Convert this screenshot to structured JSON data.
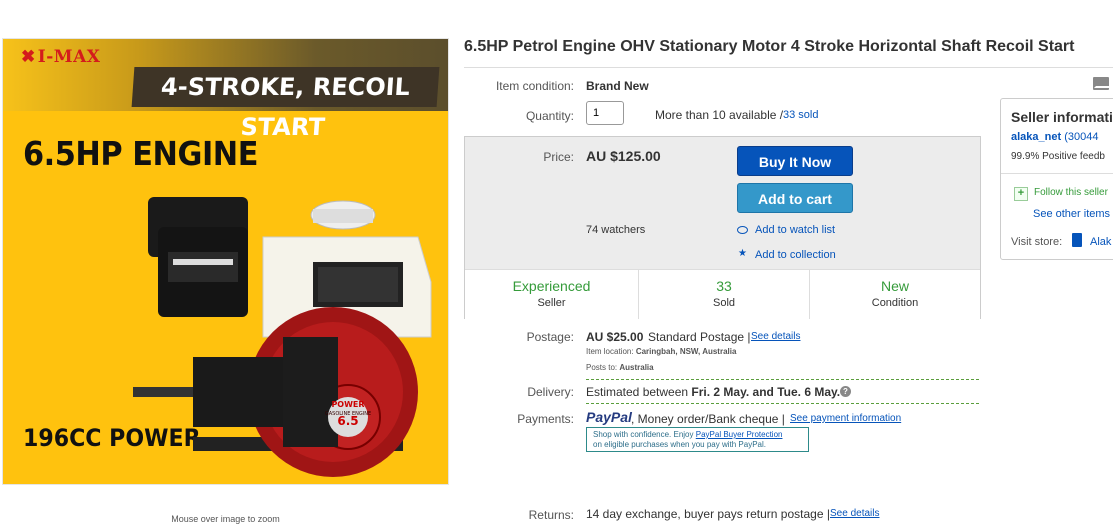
{
  "image": {
    "logo": "I-MAX",
    "banner": "4-STROKE, RECOIL START",
    "headline": "6.5HP ENGINE",
    "footline": "196CC POWER",
    "zoom_hint": "Mouse over image to zoom",
    "engine_labels": {
      "brand": "POWER",
      "model": "6.5",
      "sub": "GASOLINE ENGINE"
    }
  },
  "title": "6.5HP Petrol Engine OHV Stationary Motor 4 Stroke Horizontal Shaft Recoil Start",
  "item": {
    "condition_label": "Item condition:",
    "condition_value": "Brand New",
    "quantity_label": "Quantity:",
    "quantity_value": "1",
    "available_text": "More than 10 available /",
    "sold_link": "33 sold"
  },
  "price": {
    "label": "Price:",
    "value": "AU $125.00",
    "buy_now": "Buy It Now",
    "add_to_cart": "Add to cart",
    "watchers": "74 watchers",
    "watch_list": "Add to watch list",
    "collection": "Add to collection"
  },
  "stats": [
    {
      "top": "Experienced",
      "bottom": "Seller"
    },
    {
      "top": "33",
      "bottom": "Sold"
    },
    {
      "top": "New",
      "bottom": "Condition"
    }
  ],
  "postage": {
    "label": "Postage:",
    "value": "AU $25.00",
    "method": "Standard Postage |",
    "details_link": "See details",
    "location_label": "Item location:",
    "location_value": "Caringbah, NSW, Australia",
    "posts_label": "Posts to:",
    "posts_value": "Australia"
  },
  "delivery": {
    "label": "Delivery:",
    "prefix": "Estimated between",
    "dates": "Fri. 2 May. and Tue. 6 May."
  },
  "payments": {
    "label": "Payments:",
    "paypal": "PayPal",
    "methods": ", Money order/Bank cheque |",
    "info_link": "See payment information",
    "protect_line1": "Shop with confidence. Enjoy",
    "protect_link": "PayPal Buyer Protection",
    "protect_line2": "on eligible purchases when you pay with PayPal."
  },
  "returns": {
    "label": "Returns:",
    "value": "14 day exchange, buyer pays return postage |",
    "details_link": "See details"
  },
  "seller": {
    "heading": "Seller informati",
    "name": "alaka_net",
    "score": "(30044",
    "feedback": "99.9% Positive feedb",
    "follow": "Follow this seller",
    "other_items": "See other items",
    "store_label": "Visit store:",
    "store_name": "Alak"
  },
  "colors": {
    "link": "#0654ba",
    "buy_button": "#0654ba",
    "cart_button": "#3498ca",
    "stat_green": "#359b3a",
    "image_yellow": "#ffc20e"
  }
}
